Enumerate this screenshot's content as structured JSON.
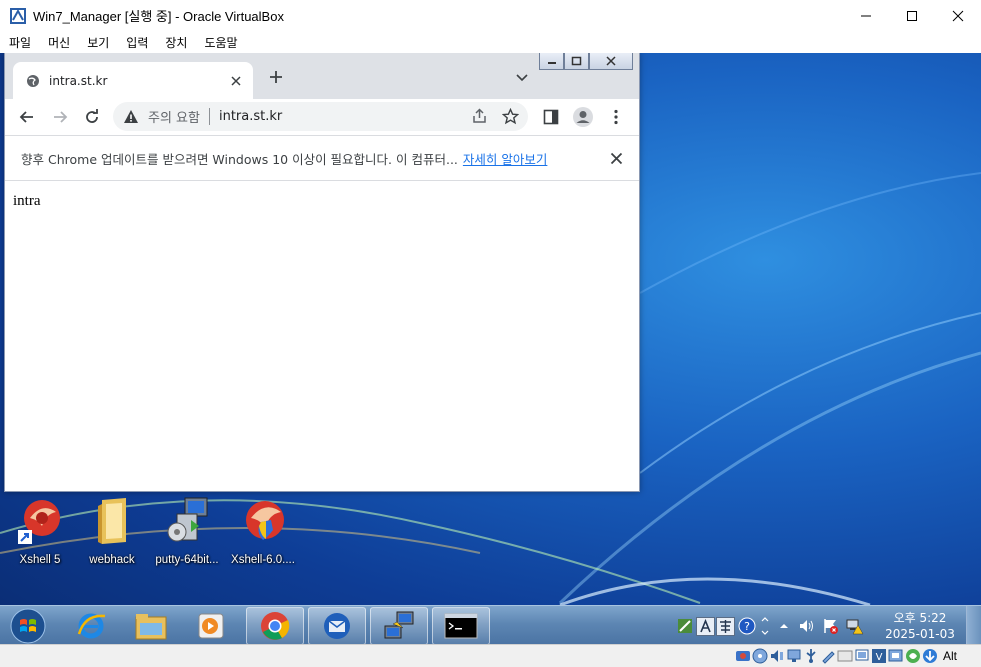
{
  "vbox": {
    "title": "Win7_Manager [실행 중] - Oracle VirtualBox",
    "menu": [
      "파일",
      "머신",
      "보기",
      "입력",
      "장치",
      "도움말"
    ],
    "host_key": "Alt"
  },
  "chrome": {
    "tab_title": "intra.st.kr",
    "security_label": "주의 요함",
    "url": "intra.st.kr",
    "infobar_message": "향후 Chrome 업데이트를 받으려면 Windows 10 이상이 필요합니다. 이 컴퓨터...",
    "infobar_link": "자세히 알아보기",
    "page_text": "intra"
  },
  "desktop_icons": [
    {
      "label": "Xshell 5",
      "icon": "xshell-icon"
    },
    {
      "label": "webhack",
      "icon": "folder-icon"
    },
    {
      "label": "putty-64bit...",
      "icon": "putty-installer-icon"
    },
    {
      "label": "Xshell-6.0....",
      "icon": "xshell-setup-icon"
    }
  ],
  "taskbar": {
    "apps": [
      "internet-explorer-icon",
      "windows-explorer-icon",
      "media-player-icon",
      "chrome-icon",
      "thunderbird-icon",
      "putty-icon",
      "cmd-icon"
    ],
    "clock_time": "오후 5:22",
    "clock_date": "2025-01-03"
  }
}
